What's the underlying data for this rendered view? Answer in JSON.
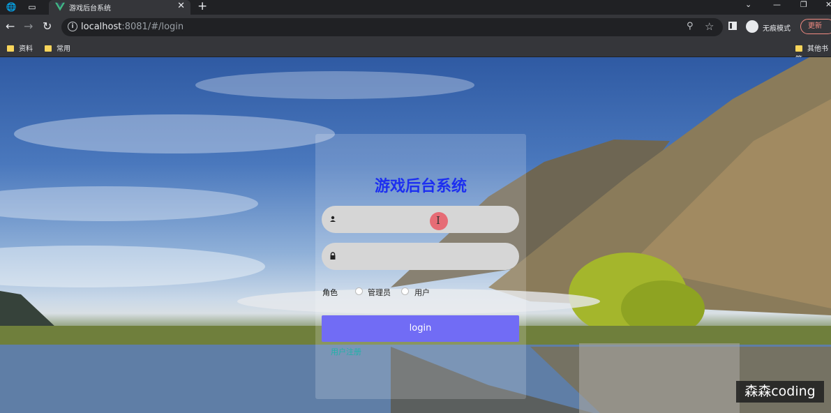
{
  "browser": {
    "tab_title": "游戏后台系统",
    "url_host": "localhost",
    "url_rest": ":8081/#/login",
    "incognito_label": "无痕模式",
    "update_label": "更新",
    "bookmarks": [
      "资料",
      "常用"
    ],
    "other_bookmarks": "其他书签"
  },
  "login": {
    "title": "游戏后台系统",
    "username_placeholder": "",
    "password_placeholder": "",
    "role_label": "角色",
    "role_options": [
      "管理员",
      "用户"
    ],
    "login_button": "login",
    "register_link": "用户注册"
  },
  "watermark": "森森coding"
}
